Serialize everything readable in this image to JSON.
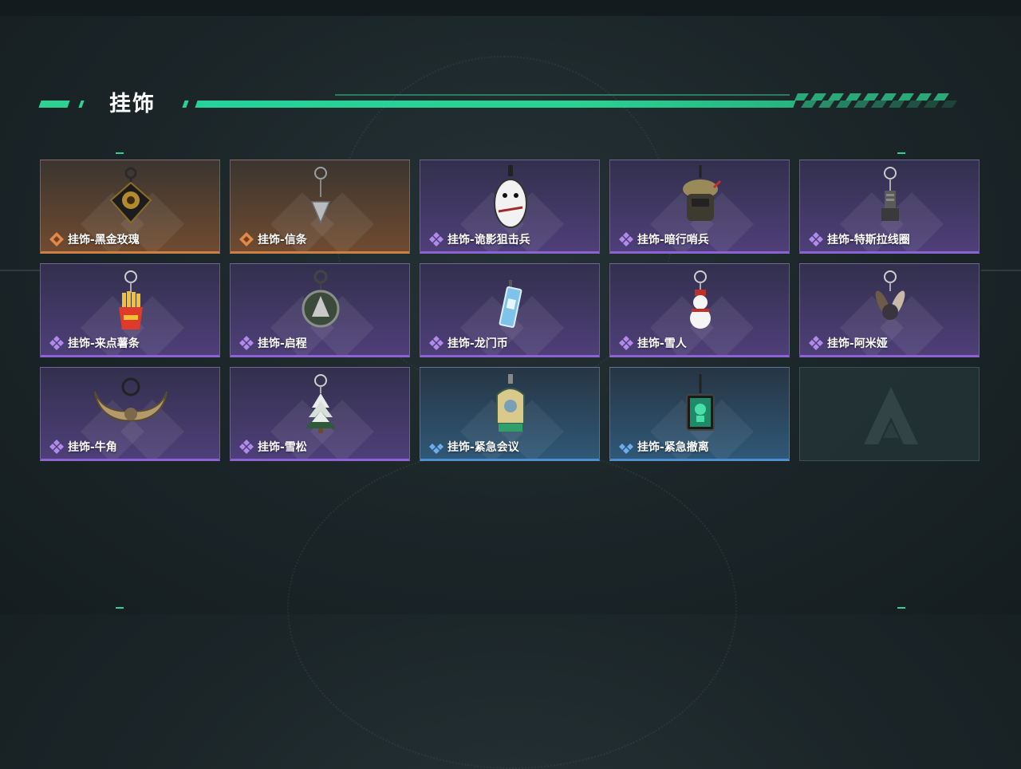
{
  "section": {
    "title": "挂饰"
  },
  "colors": {
    "accent": "#2ed191",
    "orange": "#cf7f43",
    "purple": "#8d63d3",
    "blue": "#4e8fd2"
  },
  "items": [
    {
      "label": "挂饰-黑金玫瑰",
      "rarity": "orange",
      "icon": "black-gold-rose-charm-icon"
    },
    {
      "label": "挂饰-信条",
      "rarity": "orange",
      "icon": "creed-charm-icon"
    },
    {
      "label": "挂饰-诡影狙击兵",
      "rarity": "purple",
      "icon": "shadow-sniper-charm-icon"
    },
    {
      "label": "挂饰-暗行哨兵",
      "rarity": "purple",
      "icon": "dark-sentry-charm-icon"
    },
    {
      "label": "挂饰-特斯拉线圈",
      "rarity": "purple",
      "icon": "tesla-coil-charm-icon"
    },
    {
      "label": "挂饰-来点薯条",
      "rarity": "purple",
      "icon": "fries-charm-icon"
    },
    {
      "label": "挂饰-启程",
      "rarity": "purple",
      "icon": "departure-charm-icon"
    },
    {
      "label": "挂饰-龙门币",
      "rarity": "purple",
      "icon": "lungmen-coin-charm-icon"
    },
    {
      "label": "挂饰-雪人",
      "rarity": "purple",
      "icon": "snowman-charm-icon"
    },
    {
      "label": "挂饰-阿米娅",
      "rarity": "purple",
      "icon": "amiya-charm-icon"
    },
    {
      "label": "挂饰-牛角",
      "rarity": "purple",
      "icon": "horns-charm-icon"
    },
    {
      "label": "挂饰-雪松",
      "rarity": "purple",
      "icon": "cedar-tree-charm-icon"
    },
    {
      "label": "挂饰-紧急会议",
      "rarity": "blue",
      "icon": "emergency-meeting-charm-icon"
    },
    {
      "label": "挂饰-紧急撤离",
      "rarity": "blue",
      "icon": "emergency-evac-charm-icon"
    },
    {
      "label": "",
      "rarity": "empty",
      "icon": "empty-slot-logo-icon"
    }
  ]
}
